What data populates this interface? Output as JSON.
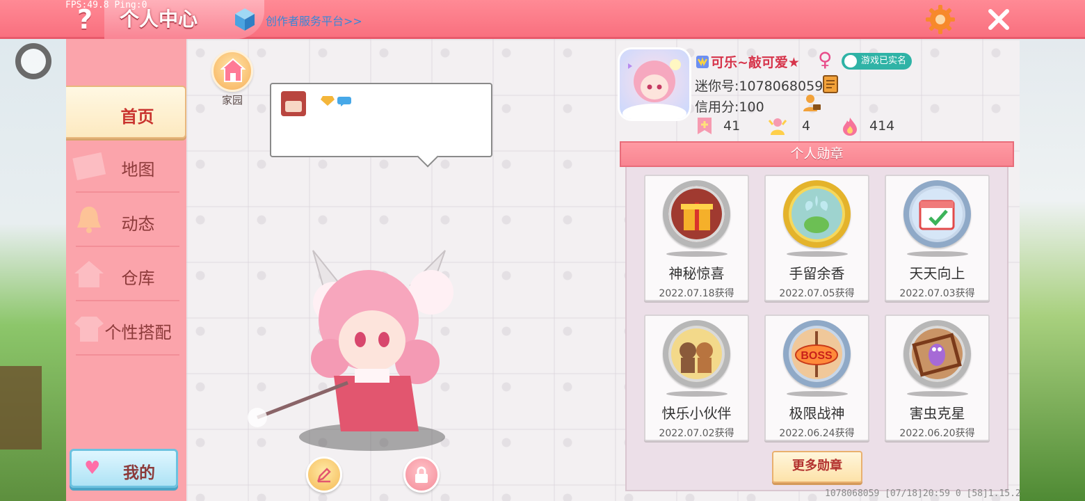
{
  "header": {
    "fps": "FPS:49.8  Ping:0",
    "title": "个人中心",
    "creator_link": "创作者服务平台>>"
  },
  "nav": {
    "items": [
      {
        "label": "首页",
        "active": true
      },
      {
        "label": "地图",
        "active": false
      },
      {
        "label": "动态",
        "active": false
      },
      {
        "label": "仓库",
        "active": false
      },
      {
        "label": "个性搭配",
        "active": false
      }
    ],
    "mine_label": "我的"
  },
  "stage": {
    "home_label": "家园"
  },
  "profile": {
    "username": "可乐~敲可爱★",
    "gender_icon": "female-icon",
    "verified": "游戏已实名",
    "mini_id": "迷你号:1078068059",
    "credit": "信用分:100",
    "stats": [
      {
        "icon": "bookmark-plus-icon",
        "value": "41"
      },
      {
        "icon": "fans-icon",
        "value": "4"
      },
      {
        "icon": "flame-icon",
        "value": "414"
      }
    ]
  },
  "medals": {
    "title": "个人勋章",
    "items": [
      {
        "name": "神秘惊喜",
        "date": "2022.07.18获得",
        "icon": "gift-medal-icon",
        "style": "silver"
      },
      {
        "name": "手留余香",
        "date": "2022.07.05获得",
        "icon": "plant-medal-icon",
        "style": "gold"
      },
      {
        "name": "天天向上",
        "date": "2022.07.03获得",
        "icon": "calendar-medal-icon",
        "style": "blue"
      },
      {
        "name": "快乐小伙伴",
        "date": "2022.07.02获得",
        "icon": "friends-medal-icon",
        "style": "silver"
      },
      {
        "name": "极限战神",
        "date": "2022.06.24获得",
        "icon": "boss-medal-icon",
        "style": "blue"
      },
      {
        "name": "害虫克星",
        "date": "2022.06.20获得",
        "icon": "bug-medal-icon",
        "style": "silver"
      }
    ],
    "more_label": "更多勋章"
  },
  "footer": {
    "info": "1078068059   [07/18]20:59 0  [58]1.15.2"
  },
  "colors": {
    "accent": "#f9707f",
    "nav_bg": "#fba4ab",
    "nav_text": "#8c3a3a",
    "active_text": "#c9342f"
  }
}
